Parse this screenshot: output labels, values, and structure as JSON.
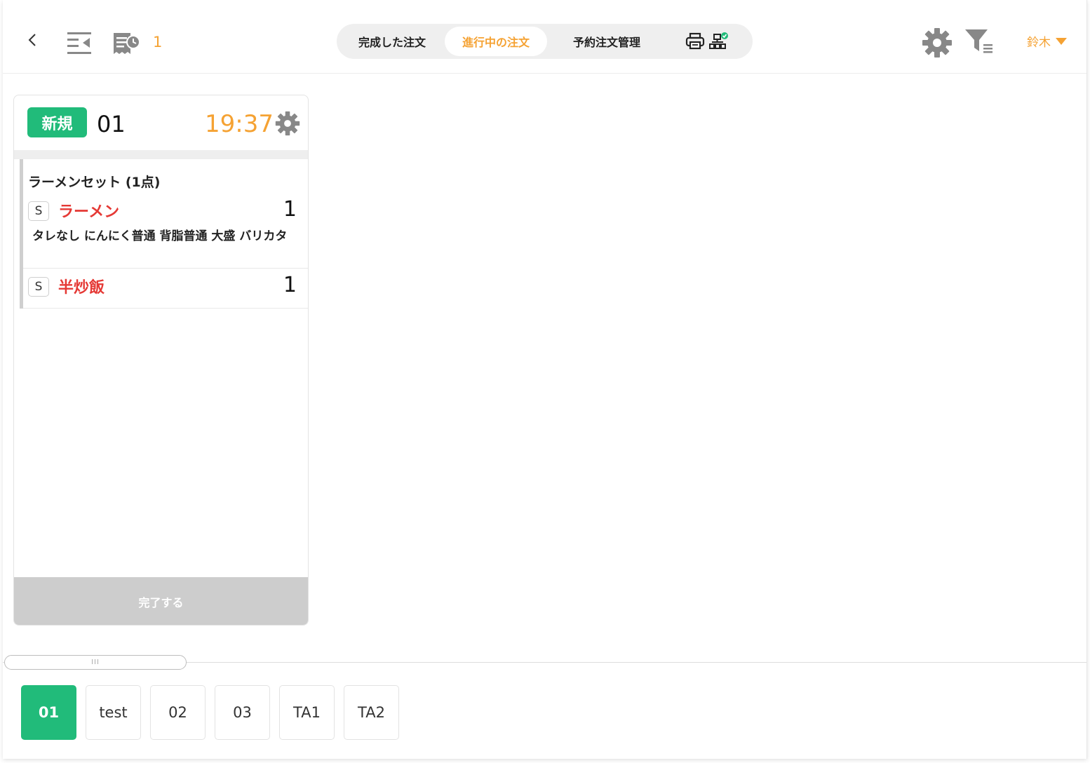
{
  "header": {
    "back_icon": "chevron-left-icon",
    "list_icon": "collapse-list-icon",
    "receipt_icon": "receipt-clock-icon",
    "pending_count": "1",
    "tabs": [
      {
        "label": "完成した注文",
        "active": false
      },
      {
        "label": "進行中の注文",
        "active": true
      },
      {
        "label": "予約注文管理",
        "active": false
      }
    ],
    "printer_icon": "printer-icon",
    "network_icon": "network-status-icon",
    "settings_icon": "gear-icon",
    "filter_icon": "filter-list-icon",
    "user_name": "鈴木",
    "user_dropdown_icon": "caret-down-icon"
  },
  "order": {
    "badge": "新規",
    "table_no": "01",
    "time": "19:37",
    "settings_icon": "gear-icon",
    "set_title": "ラーメンセット (1点)",
    "items": [
      {
        "size": "S",
        "name": "ラーメン",
        "qty": "1",
        "options": "タレなし にんにく普通 背脂普通 大盛 バリカタ"
      },
      {
        "size": "S",
        "name": "半炒飯",
        "qty": "1",
        "options": ""
      }
    ],
    "complete_label": "完了する"
  },
  "scroll": {
    "grip": "III"
  },
  "tables": [
    {
      "label": "01",
      "active": true
    },
    {
      "label": "test",
      "active": false
    },
    {
      "label": "02",
      "active": false
    },
    {
      "label": "03",
      "active": false
    },
    {
      "label": "TA1",
      "active": false
    },
    {
      "label": "TA2",
      "active": false
    }
  ],
  "colors": {
    "accent_orange": "#f5a233",
    "accent_green": "#21bb7a",
    "item_red": "#e53935",
    "disabled_gray": "#cdcdcd"
  }
}
